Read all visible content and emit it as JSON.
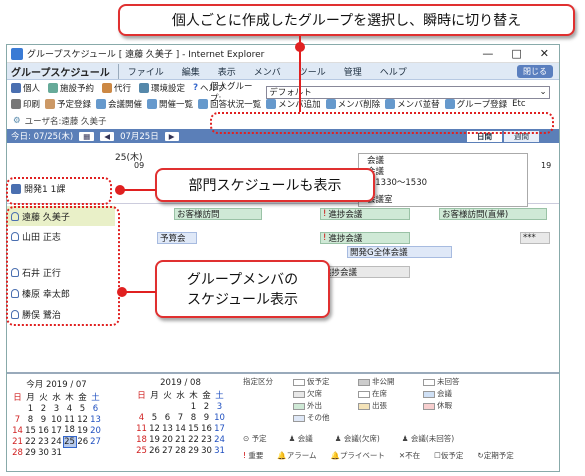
{
  "window": {
    "title": "グループスケジュール [ 遠藤 久美子 ] - Internet Explorer",
    "controls": [
      "—",
      "□",
      "✕"
    ]
  },
  "menubar": {
    "app": "グループスケジュール",
    "items": [
      "ファイル",
      "編集",
      "表示",
      "メンバ",
      "ツール",
      "管理",
      "ヘルプ"
    ],
    "close": "閉じる"
  },
  "toolbar1": [
    "個人",
    "施設予約",
    "代行",
    "環境設定",
    "ヘルプ"
  ],
  "toolbar2": [
    "印刷",
    "予定登録",
    "会議開催",
    "開催一覧",
    "回答状況一覧",
    "メンバ追加",
    "メンバ削除",
    "メンバ並替",
    "グループ登録",
    "Etc"
  ],
  "user": {
    "label": "ユーザ名:遠藤 久美子"
  },
  "group_select": {
    "label": "個人グループ:",
    "value": "デフォルト"
  },
  "datebar": {
    "today": "今日: 07/25(木)",
    "range": "07月25日",
    "tabs": [
      "日間",
      "週間"
    ]
  },
  "schedule": {
    "day_label": "25(木)",
    "hours": [
      "09",
      "19"
    ],
    "dept": "開発1 1課",
    "members": [
      "遠藤 久美子",
      "山田 正志",
      "石井 正行",
      "榛原 幸太郎",
      "勝俣 鷺治"
    ],
    "events": {
      "visit1": "お客様訪問",
      "meet1": "進捗会議",
      "visit2": "お客様訪問(直帰)",
      "budget": "予算会",
      "meet2": "進捗会議",
      "allhands": "開発G全体会議",
      "meet3": "進捗会議",
      "hidden": "***"
    },
    "popup": [
      "会議",
      "会議",
      "5:1330～1530",
      "会議室"
    ]
  },
  "calendars": [
    {
      "title": "今月 2019 / 07",
      "weekdays": [
        "日",
        "月",
        "火",
        "水",
        "木",
        "金",
        "土"
      ],
      "weeks": [
        [
          "",
          "1",
          "2",
          "3",
          "4",
          "5",
          "6"
        ],
        [
          "7",
          "8",
          "9",
          "10",
          "11",
          "12",
          "13"
        ],
        [
          "14",
          "15",
          "16",
          "17",
          "18",
          "19",
          "20"
        ],
        [
          "21",
          "22",
          "23",
          "24",
          "25",
          "26",
          "27"
        ],
        [
          "28",
          "29",
          "30",
          "31",
          "",
          "",
          ""
        ]
      ]
    },
    {
      "title": "2019 / 08",
      "weekdays": [
        "日",
        "月",
        "火",
        "水",
        "木",
        "金",
        "土"
      ],
      "weeks": [
        [
          "",
          "",
          "",
          "",
          "1",
          "2",
          "3"
        ],
        [
          "4",
          "5",
          "6",
          "7",
          "8",
          "9",
          "10"
        ],
        [
          "11",
          "12",
          "13",
          "14",
          "15",
          "16",
          "17"
        ],
        [
          "18",
          "19",
          "20",
          "21",
          "22",
          "23",
          "24"
        ],
        [
          "25",
          "26",
          "27",
          "28",
          "29",
          "30",
          "31"
        ]
      ]
    }
  ],
  "legend": {
    "title": "指定区分",
    "items": [
      "仮予定",
      "非公開",
      "未回答",
      "欠席",
      "在席",
      "会議",
      "外出",
      "出張",
      "休暇",
      "その他"
    ],
    "icons": [
      "予定",
      "会議",
      "会議(欠席)",
      "会議(未回答)"
    ],
    "icons2": [
      "重要",
      "アラーム",
      "プライベート",
      "不在",
      "仮予定",
      "定期予定"
    ]
  },
  "callouts": {
    "top": "個人ごとに作成したグループを選択し、瞬時に切り替え",
    "dept": "部門スケジュールも表示",
    "members": "グループメンバの\nスケジュール表示"
  }
}
